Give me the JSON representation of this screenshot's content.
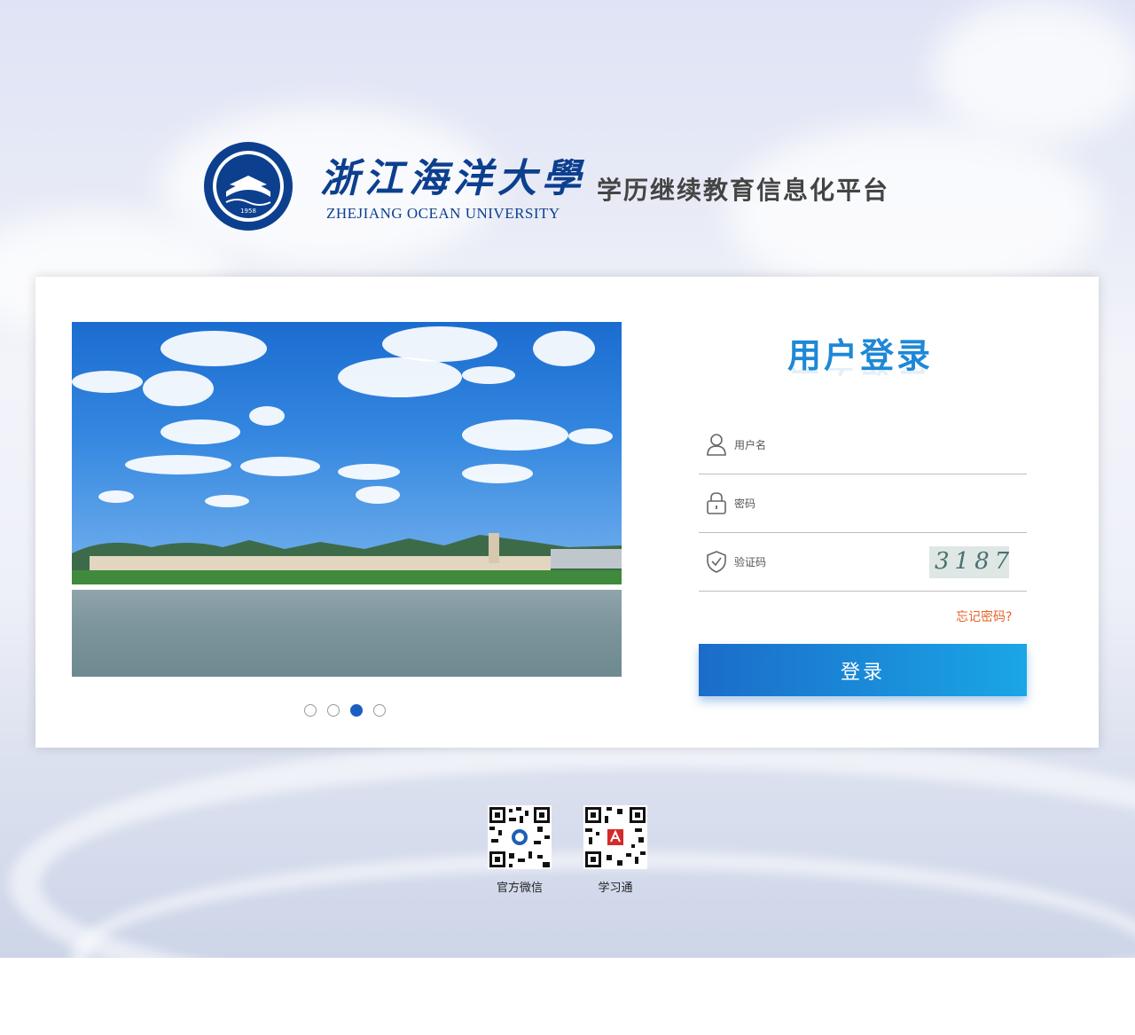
{
  "header": {
    "brand_cn": "浙江海洋大學",
    "brand_en": "ZHEJIANG OCEAN UNIVERSITY",
    "platform_title": "学历继续教育信息化平台",
    "emblem_year": "1958",
    "emblem_text": "ZHEJIANG OCEAN UNIVERSITY"
  },
  "carousel": {
    "slide_count": 4,
    "active_index": 2
  },
  "login": {
    "title": "用户登录",
    "username_placeholder": "用户名",
    "password_placeholder": "密码",
    "captcha_placeholder": "验证码",
    "captcha_text": "3187",
    "forgot_label": "忘记密码?",
    "submit_label": "登录"
  },
  "footer": {
    "qr_codes": [
      {
        "label": "官方微信",
        "icon": "wechat-qr-icon"
      },
      {
        "label": "学习通",
        "icon": "xuexitong-qr-icon"
      }
    ]
  },
  "colors": {
    "brand_blue": "#0d3f8f",
    "title_blue": "#1f88d6",
    "button_start": "#1b6cc9",
    "button_end": "#1aa6e6",
    "forgot_orange": "#e8622a",
    "active_dot": "#1b5fc4"
  }
}
